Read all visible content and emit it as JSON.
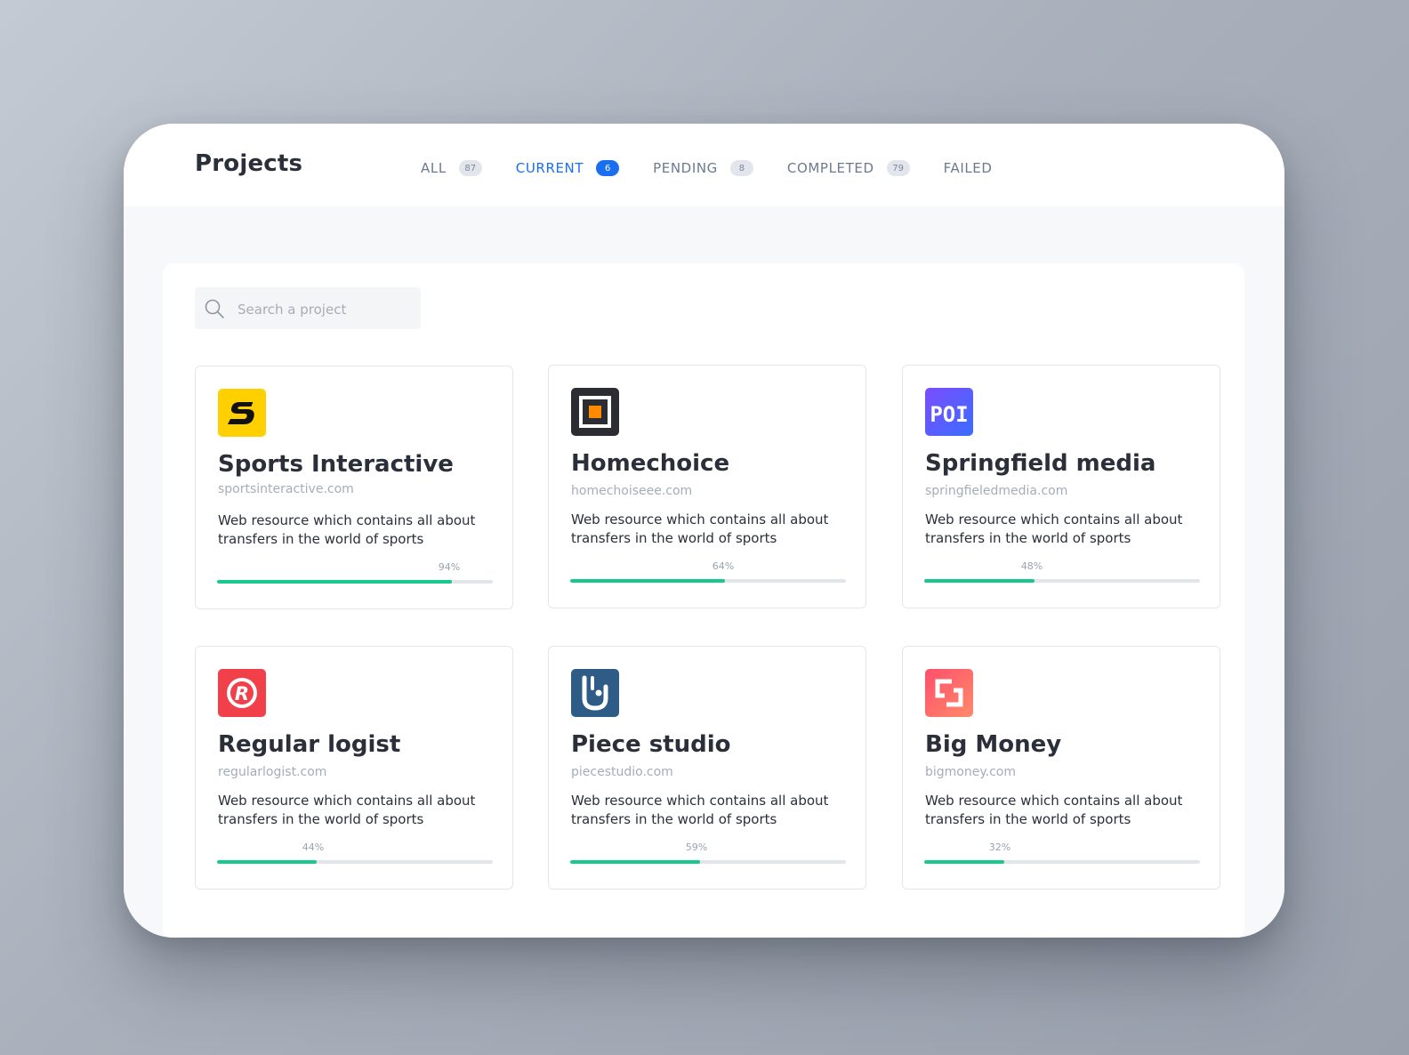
{
  "header": {
    "title": "Projects",
    "tabs": [
      {
        "label": "ALL",
        "count": "87",
        "active": false
      },
      {
        "label": "CURRENT",
        "count": "6",
        "active": true
      },
      {
        "label": "PENDING",
        "count": "8",
        "active": false
      },
      {
        "label": "COMPLETED",
        "count": "79",
        "active": false
      },
      {
        "label": "FAILED",
        "count": null,
        "active": false
      }
    ]
  },
  "search": {
    "placeholder": "Search a project",
    "value": ""
  },
  "colors": {
    "accent": "#1a6ff0",
    "progress": "#17c98b"
  },
  "projects": [
    {
      "name": "Sports Interactive",
      "url": "sportsinteractive.com",
      "description": "Web resource which contains all about transfers in the world of sports",
      "progress": 94,
      "progress_label": "94%",
      "logo": "sports-interactive-logo",
      "logo_fill": 0.85
    },
    {
      "name": "Homechoice",
      "url": "homechoiseee.com",
      "description": "Web resource which contains all about transfers in the world of sports",
      "progress": 64,
      "progress_label": "64%",
      "logo": "homechoice-logo",
      "logo_fill": 0.56
    },
    {
      "name": "Springfield media",
      "url": "springfieledmedia.com",
      "description": "Web resource which contains all about transfers in the world of sports",
      "progress": 48,
      "progress_label": "48%",
      "logo": "springfield-media-logo",
      "logo_text": "POI",
      "logo_fill": 0.4
    },
    {
      "name": "Regular logist",
      "url": "regularlogist.com",
      "description": "Web resource which contains all about transfers in the world of sports",
      "progress": 44,
      "progress_label": "44%",
      "logo": "regular-logist-logo",
      "logo_text": "R",
      "logo_fill": 0.36
    },
    {
      "name": "Piece studio",
      "url": "piecestudio.com",
      "description": "Web resource which contains all about transfers in the world of sports",
      "progress": 59,
      "progress_label": "59%",
      "logo": "piece-studio-logo",
      "logo_fill": 0.47
    },
    {
      "name": "Big Money",
      "url": "bigmoney.com",
      "description": "Web resource which contains all about transfers in the world of sports",
      "progress": 32,
      "progress_label": "32%",
      "logo": "big-money-logo",
      "logo_fill": 0.29
    }
  ]
}
